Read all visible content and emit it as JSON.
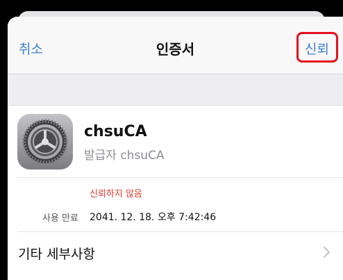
{
  "nav": {
    "cancel_label": "취소",
    "title": "인증서",
    "trust_label": "신뢰"
  },
  "certificate": {
    "name": "chsuCA",
    "issuer": "발급자 chsuCA",
    "status": "신뢰하지 않음",
    "expiry_label": "사용 만료",
    "expiry_value": "2041. 12. 18. 오후 7:42:46",
    "icon": "settings-gear-icon"
  },
  "details": {
    "label": "기타 세부사항",
    "icon": "chevron-right-icon"
  },
  "colors": {
    "accent": "#3b7fd6",
    "highlight": "#e4101c",
    "warning": "#e03a2e"
  }
}
